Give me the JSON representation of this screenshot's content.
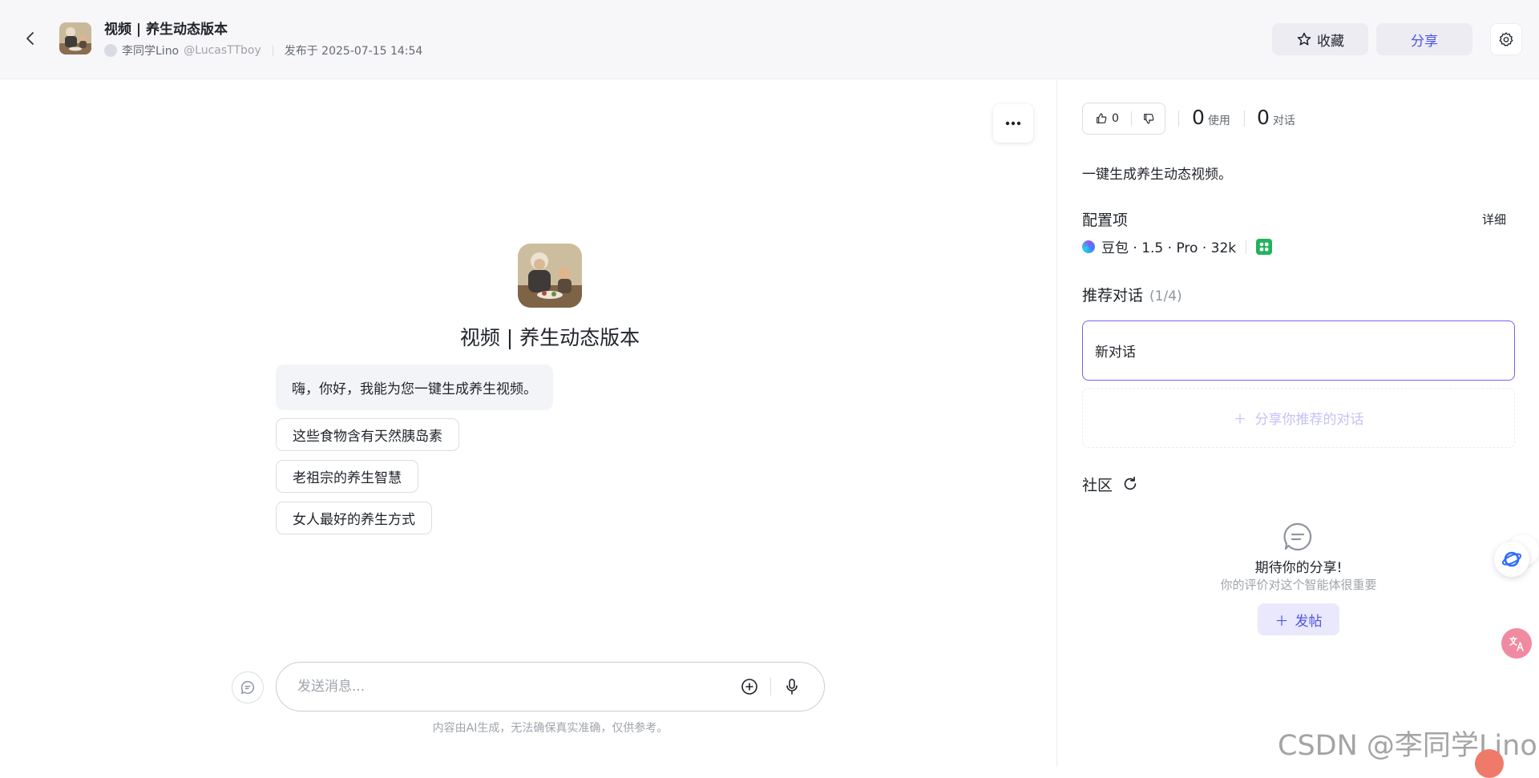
{
  "header": {
    "bot_title": "视频 | 养生动态版本",
    "author_name": "李同学Lino",
    "author_handle": "@LucasTTboy",
    "published": "发布于 2025-07-15 14:54",
    "favorite_label": "收藏",
    "share_label": "分享"
  },
  "main": {
    "bot_name": "视频 | 养生动态版本",
    "greeting": "嗨，你好，我能为您一键生成养生视频。",
    "suggestions": [
      "这些食物含有天然胰岛素",
      "老祖宗的养生智慧",
      "女人最好的养生方式"
    ],
    "input_placeholder": "发送消息...",
    "disclaimer": "内容由AI生成，无法确保真实准确，仅供参考。"
  },
  "sidebar": {
    "likes": "0",
    "uses_count": "0",
    "uses_label": "使用",
    "chats_count": "0",
    "chats_label": "对话",
    "description": "一键生成养生动态视频。",
    "config_title": "配置项",
    "detail_label": "详细",
    "model": "豆包 · 1.5 · Pro · 32k",
    "recommended_title": "推荐对话",
    "recommended_count": "(1/4)",
    "recommended_item": "新对话",
    "share_recommended": "分享你推荐的对话",
    "community_title": "社区",
    "empty_title": "期待你的分享!",
    "empty_subtitle": "你的评价对这个智能体很重要",
    "post_label": "发帖"
  },
  "watermark": "CSDN @李同学Lino",
  "colors": {
    "accent": "#4d53e8",
    "border_active": "#6f66e8",
    "plugin_green": "#21b35b"
  }
}
